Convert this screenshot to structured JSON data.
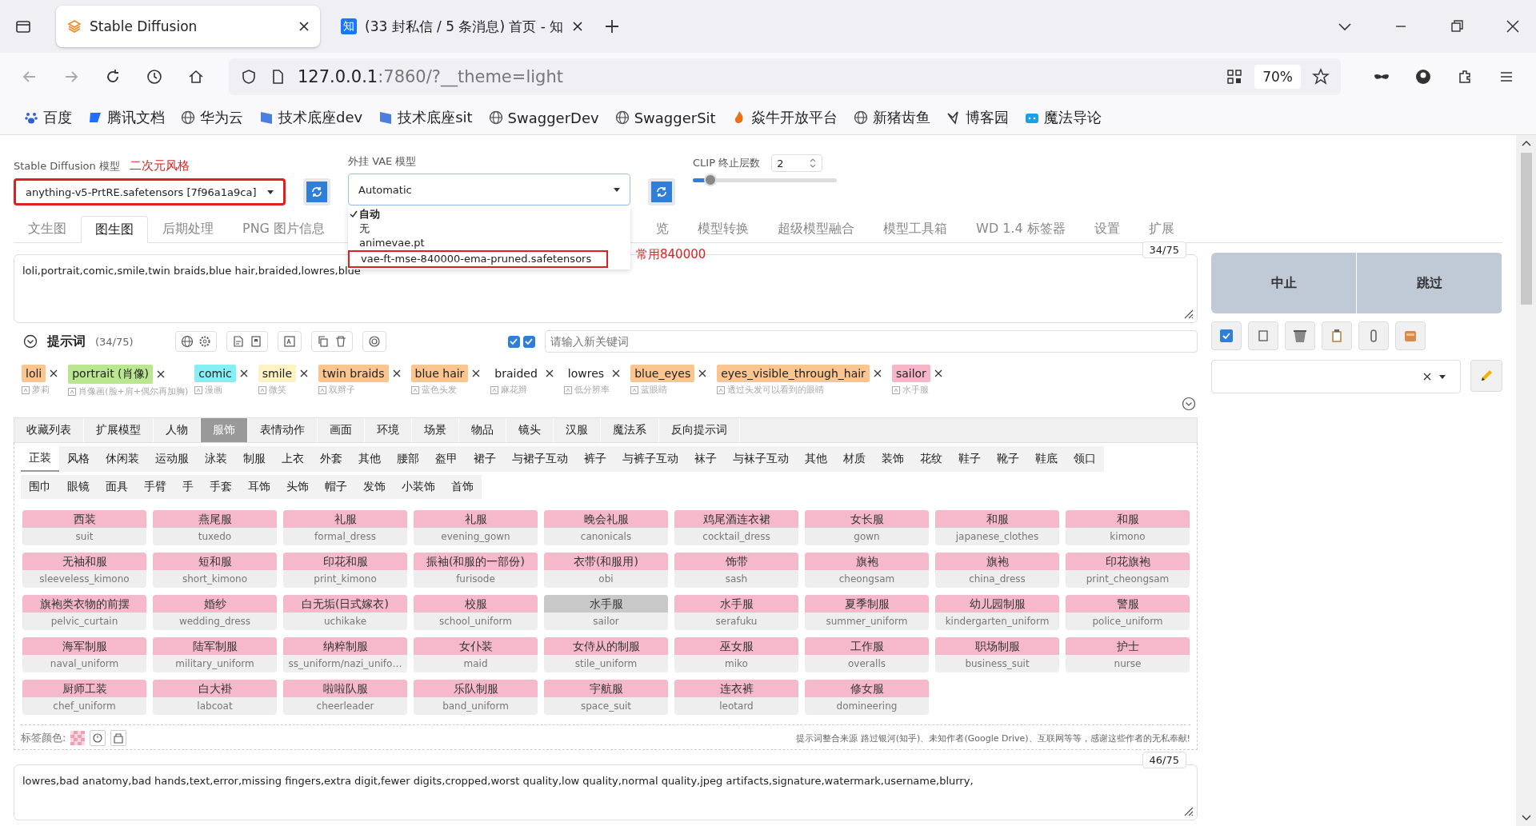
{
  "browser": {
    "tabs": [
      {
        "title": "Stable Diffusion",
        "selected": true,
        "kind": "sd"
      },
      {
        "title": "(33 封私信 / 5 条消息) 首页 - 知",
        "selected": false,
        "kind": "zhihu"
      }
    ],
    "zhihu_badge": "知",
    "address": {
      "host": "127.0.0.1",
      "rest": ":7860/?__theme=light"
    },
    "zoom": "70%",
    "bookmarks": [
      {
        "label": "百度",
        "kind": "paw",
        "color": "#2f5fd8"
      },
      {
        "label": "腾讯文档",
        "kind": "doc",
        "color": "#1e6fff"
      },
      {
        "label": "华为云",
        "kind": "globe",
        "color": "#555555"
      },
      {
        "label": "技术底座dev",
        "kind": "flag",
        "color": "#4a7fe0"
      },
      {
        "label": "技术底座sit",
        "kind": "flag",
        "color": "#4a7fe0"
      },
      {
        "label": "SwaggerDev",
        "kind": "globe",
        "color": "#555555"
      },
      {
        "label": "SwaggerSit",
        "kind": "globe",
        "color": "#555555"
      },
      {
        "label": "焱牛开放平台",
        "kind": "flame",
        "color": "#e8731a"
      },
      {
        "label": "新猪齿鱼",
        "kind": "globe",
        "color": "#555555"
      },
      {
        "label": "博客园",
        "kind": "bird",
        "color": "#333333"
      },
      {
        "label": "魔法导论",
        "kind": "tv",
        "color": "#1aa0e8"
      }
    ]
  },
  "model": {
    "label": "Stable Diffusion 模型",
    "note": "二次元风格",
    "value": "anything-v5-PrtRE.safetensors [7f96a1a9ca]",
    "highlighted": true
  },
  "vae": {
    "label": "外挂 VAE 模型",
    "value": "Automatic",
    "note": "常用840000",
    "options": [
      {
        "label": "自动",
        "selected": true,
        "highlighted": false
      },
      {
        "label": "无",
        "selected": false,
        "highlighted": false
      },
      {
        "label": "animevae.pt",
        "selected": false,
        "highlighted": false
      },
      {
        "label": "vae-ft-mse-840000-ema-pruned.safetensors",
        "selected": false,
        "highlighted": true
      }
    ]
  },
  "clip": {
    "label": "CLIP 终止层数",
    "value": "2",
    "level": 0.12
  },
  "tabs": [
    {
      "label": "文生图",
      "selected": false
    },
    {
      "label": "图生图",
      "selected": true
    },
    {
      "label": "后期处理",
      "selected": false
    },
    {
      "label": "PNG 图片信息",
      "selected": false
    },
    {
      "label": "览",
      "selected": false
    },
    {
      "label": "模型转换",
      "selected": false
    },
    {
      "label": "超级模型融合",
      "selected": false
    },
    {
      "label": "模型工具箱",
      "selected": false
    },
    {
      "label": "WD 1.4 标签器",
      "selected": false
    },
    {
      "label": "设置",
      "selected": false
    },
    {
      "label": "扩展",
      "selected": false
    }
  ],
  "prompt": {
    "text": "loli,portrait,comic,smile,twin braids,blue hair,braided,lowres,blue",
    "counter": "34/75"
  },
  "actions": {
    "stop": "中止",
    "skip": "跳过"
  },
  "toolbar": {
    "title": "提示词",
    "count": "(34/75)",
    "checks": [
      {
        "checked": true
      },
      {
        "checked": true
      }
    ],
    "placeholder": "请输入新关键词"
  },
  "chips": [
    {
      "label": "loli",
      "translation": "萝莉",
      "color": "#fbc58f"
    },
    {
      "label": "portrait (肖像)",
      "translation": "肖像画(脸+肩+偶尔再加胸)",
      "color": "#b9e68f"
    },
    {
      "label": "comic",
      "translation": "漫画",
      "color": "#84f0f5"
    },
    {
      "label": "smile",
      "translation": "微笑",
      "color": "#fdf2c4"
    },
    {
      "label": "twin braids",
      "translation": "双辫子",
      "color": "#fbc58f"
    },
    {
      "label": "blue hair",
      "translation": "蓝色头发",
      "color": "#fbc58f"
    },
    {
      "label": "braided",
      "translation": "麻花辫",
      "color": "#ffffff"
    },
    {
      "label": "lowres",
      "translation": "低分辨率",
      "color": "#ffffff"
    },
    {
      "label": "blue_eyes",
      "translation": "蓝眼睛",
      "color": "#fbc58f"
    },
    {
      "label": "eyes_visible_through_hair",
      "translation": "透过头发可以看到的眼睛",
      "color": "#fbc58f"
    },
    {
      "label": "sailor",
      "translation": "水手服",
      "color": "#f6b6c8"
    }
  ],
  "categories": [
    {
      "label": "收藏列表",
      "selected": false
    },
    {
      "label": "扩展模型",
      "selected": false
    },
    {
      "label": "人物",
      "selected": false
    },
    {
      "label": "服饰",
      "selected": true
    },
    {
      "label": "表情动作",
      "selected": false
    },
    {
      "label": "画面",
      "selected": false
    },
    {
      "label": "环境",
      "selected": false
    },
    {
      "label": "场景",
      "selected": false
    },
    {
      "label": "物品",
      "selected": false
    },
    {
      "label": "镜头",
      "selected": false
    },
    {
      "label": "汉服",
      "selected": false
    },
    {
      "label": "魔法系",
      "selected": false
    },
    {
      "label": "反向提示词",
      "selected": false
    }
  ],
  "subcategories": [
    {
      "label": "正装",
      "selected": true
    },
    {
      "label": "风格",
      "selected": false
    },
    {
      "label": "休闲装",
      "selected": false
    },
    {
      "label": "运动服",
      "selected": false
    },
    {
      "label": "泳装",
      "selected": false
    },
    {
      "label": "制服",
      "selected": false
    },
    {
      "label": "上衣",
      "selected": false
    },
    {
      "label": "外套",
      "selected": false
    },
    {
      "label": "其他",
      "selected": false
    },
    {
      "label": "腰部",
      "selected": false
    },
    {
      "label": "盔甲",
      "selected": false
    },
    {
      "label": "裙子",
      "selected": false
    },
    {
      "label": "与裙子互动",
      "selected": false
    },
    {
      "label": "裤子",
      "selected": false
    },
    {
      "label": "与裤子互动",
      "selected": false
    },
    {
      "label": "袜子",
      "selected": false
    },
    {
      "label": "与袜子互动",
      "selected": false
    },
    {
      "label": "其他",
      "selected": false
    },
    {
      "label": "材质",
      "selected": false
    },
    {
      "label": "装饰",
      "selected": false
    },
    {
      "label": "花纹",
      "selected": false
    },
    {
      "label": "鞋子",
      "selected": false
    },
    {
      "label": "靴子",
      "selected": false
    },
    {
      "label": "鞋底",
      "selected": false
    },
    {
      "label": "领口",
      "selected": false
    },
    {
      "label": "围巾",
      "selected": false
    },
    {
      "label": "眼镜",
      "selected": false
    },
    {
      "label": "面具",
      "selected": false
    },
    {
      "label": "手臂",
      "selected": false
    },
    {
      "label": "手",
      "selected": false
    },
    {
      "label": "手套",
      "selected": false
    },
    {
      "label": "耳饰",
      "selected": false
    },
    {
      "label": "头饰",
      "selected": false
    },
    {
      "label": "帽子",
      "selected": false
    },
    {
      "label": "发饰",
      "selected": false
    },
    {
      "label": "小装饰",
      "selected": false
    },
    {
      "label": "首饰",
      "selected": false
    }
  ],
  "keywords": [
    {
      "cn": "西装",
      "en": "suit",
      "selected": false
    },
    {
      "cn": "燕尾服",
      "en": "tuxedo",
      "selected": false
    },
    {
      "cn": "礼服",
      "en": "formal_dress",
      "selected": false
    },
    {
      "cn": "礼服",
      "en": "evening_gown",
      "selected": false
    },
    {
      "cn": "晚会礼服",
      "en": "canonicals",
      "selected": false
    },
    {
      "cn": "鸡尾酒连衣裙",
      "en": "cocktail_dress",
      "selected": false
    },
    {
      "cn": "女长服",
      "en": "gown",
      "selected": false
    },
    {
      "cn": "和服",
      "en": "japanese_clothes",
      "selected": false
    },
    {
      "cn": "和服",
      "en": "kimono",
      "selected": false
    },
    {
      "cn": "无袖和服",
      "en": "sleeveless_kimono",
      "selected": false
    },
    {
      "cn": "短和服",
      "en": "short_kimono",
      "selected": false
    },
    {
      "cn": "印花和服",
      "en": "print_kimono",
      "selected": false
    },
    {
      "cn": "振袖(和服的一部份)",
      "en": "furisode",
      "selected": false
    },
    {
      "cn": "衣带(和服用)",
      "en": "obi",
      "selected": false
    },
    {
      "cn": "饰带",
      "en": "sash",
      "selected": false
    },
    {
      "cn": "旗袍",
      "en": "cheongsam",
      "selected": false
    },
    {
      "cn": "旗袍",
      "en": "china_dress",
      "selected": false
    },
    {
      "cn": "印花旗袍",
      "en": "print_cheongsam",
      "selected": false
    },
    {
      "cn": "旗袍类衣物的前摆",
      "en": "pelvic_curtain",
      "selected": false
    },
    {
      "cn": "婚纱",
      "en": "wedding_dress",
      "selected": false
    },
    {
      "cn": "白无垢(日式嫁衣)",
      "en": "uchikake",
      "selected": false
    },
    {
      "cn": "校服",
      "en": "school_uniform",
      "selected": false
    },
    {
      "cn": "水手服",
      "en": "sailor",
      "selected": true
    },
    {
      "cn": "水手服",
      "en": "serafuku",
      "selected": false
    },
    {
      "cn": "夏季制服",
      "en": "summer_uniform",
      "selected": false
    },
    {
      "cn": "幼儿园制服",
      "en": "kindergarten_uniform",
      "selected": false
    },
    {
      "cn": "警服",
      "en": "police_uniform",
      "selected": false
    },
    {
      "cn": "海军制服",
      "en": "naval_uniform",
      "selected": false
    },
    {
      "cn": "陆军制服",
      "en": "military_uniform",
      "selected": false
    },
    {
      "cn": "纳粹制服",
      "en": "ss_uniform/nazi_unifo…",
      "selected": false
    },
    {
      "cn": "女仆装",
      "en": "maid",
      "selected": false
    },
    {
      "cn": "女侍从的制服",
      "en": "stile_uniform",
      "selected": false
    },
    {
      "cn": "巫女服",
      "en": "miko",
      "selected": false
    },
    {
      "cn": "工作服",
      "en": "overalls",
      "selected": false
    },
    {
      "cn": "职场制服",
      "en": "business_suit",
      "selected": false
    },
    {
      "cn": "护士",
      "en": "nurse",
      "selected": false
    },
    {
      "cn": "厨师工装",
      "en": "chef_uniform",
      "selected": false
    },
    {
      "cn": "白大褂",
      "en": "labcoat",
      "selected": false
    },
    {
      "cn": "啦啦队服",
      "en": "cheerleader",
      "selected": false
    },
    {
      "cn": "乐队制服",
      "en": "band_uniform",
      "selected": false
    },
    {
      "cn": "宇航服",
      "en": "space_suit",
      "selected": false
    },
    {
      "cn": "连衣裤",
      "en": "leotard",
      "selected": false
    },
    {
      "cn": "修女服",
      "en": "domineering",
      "selected": false
    }
  ],
  "footer": {
    "label": "标签颜色:",
    "credit": "提示词整合来源 路过银河(知乎)、未知作者(Google Drive)、互联网等等，感谢这些作者的无私奉献!"
  },
  "negative": {
    "text": "lowres,bad anatomy,bad hands,text,error,missing fingers,extra digit,fewer digits,cropped,worst quality,low quality,normal quality,jpeg artifacts,signature,watermark,username,blurry,",
    "counter": "46/75"
  }
}
